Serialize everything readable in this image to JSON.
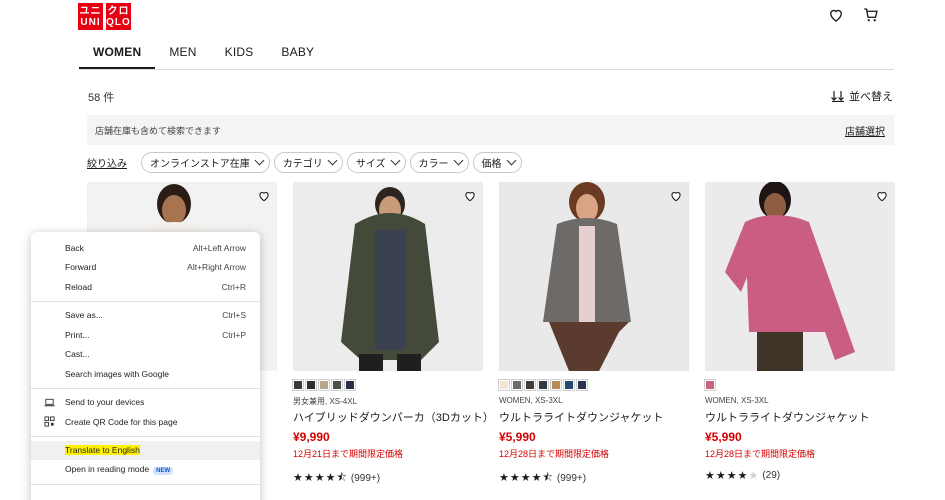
{
  "header": {
    "logo_top": "ユニ クロ",
    "logo_bottom": "UNI QLO",
    "logo_color": "#e60012",
    "icons": [
      "heart-icon",
      "cart-icon"
    ]
  },
  "tabs": [
    {
      "label": "WOMEN",
      "active": true
    },
    {
      "label": "MEN",
      "active": false
    },
    {
      "label": "KIDS",
      "active": false
    },
    {
      "label": "BABY",
      "active": false
    }
  ],
  "results": {
    "count": "58 件",
    "sort_label": "並べ替え"
  },
  "stock_bar": {
    "text": "店舗在庫も含めて検索できます",
    "link": "店舗選択"
  },
  "filters": {
    "narrow_label": "絞り込み",
    "chips": [
      "オンラインストア在庫",
      "カテゴリ",
      "サイズ",
      "カラー",
      "価格"
    ]
  },
  "products": [
    {
      "meta": "男女兼用, XS-4XL",
      "name": "ハイブリッドダウンパーカ（3Dカット）",
      "price": "¥9,990",
      "promo": "12月21日まで期間限定価格",
      "stars": "★★★★⯪",
      "reviews": "(999+)",
      "swatches": [
        "#3a3a3a",
        "#2a2f33",
        "#b4a78a",
        "#4a4f4a",
        "#2b2e45"
      ]
    },
    {
      "meta": "WOMEN, XS-3XL",
      "name": "ウルトラライトダウンジャケット",
      "price": "¥5,990",
      "promo": "12月28日まで期間限定価格",
      "stars": "★★★★⯪",
      "reviews": "(999+)",
      "swatches": [
        "#efe6d6",
        "#6c6c6c",
        "#3d3d3d",
        "#2f3a45",
        "#b98a5a",
        "#274a6e",
        "#2b3552"
      ]
    },
    {
      "meta": "WOMEN, XS-3XL",
      "name": "ウルトラライトダウンジャケット",
      "price": "¥5,990",
      "promo": "12月28日まで期間限定価格",
      "stars": "★★★★",
      "stars_empty": "★",
      "reviews": "(29)",
      "swatches": [
        "#c8657e"
      ]
    }
  ],
  "context_menu": {
    "groups": [
      [
        {
          "label": "Back",
          "shortcut": "Alt+Left Arrow"
        },
        {
          "label": "Forward",
          "shortcut": "Alt+Right Arrow"
        },
        {
          "label": "Reload",
          "shortcut": "Ctrl+R"
        }
      ],
      [
        {
          "label": "Save as...",
          "shortcut": "Ctrl+S"
        },
        {
          "label": "Print...",
          "shortcut": "Ctrl+P"
        },
        {
          "label": "Cast..."
        },
        {
          "label": "Search images with Google"
        }
      ],
      [
        {
          "label": "Send to your devices",
          "icon": "laptop-icon"
        },
        {
          "label": "Create QR Code for this page",
          "icon": "qr-code-icon"
        }
      ],
      [
        {
          "label": "Translate to English",
          "highlighted": true
        },
        {
          "label": "Open in reading mode",
          "badge": "NEW"
        }
      ]
    ]
  },
  "colors": {
    "price_red": "#d50000",
    "highlight": "#fff200"
  }
}
